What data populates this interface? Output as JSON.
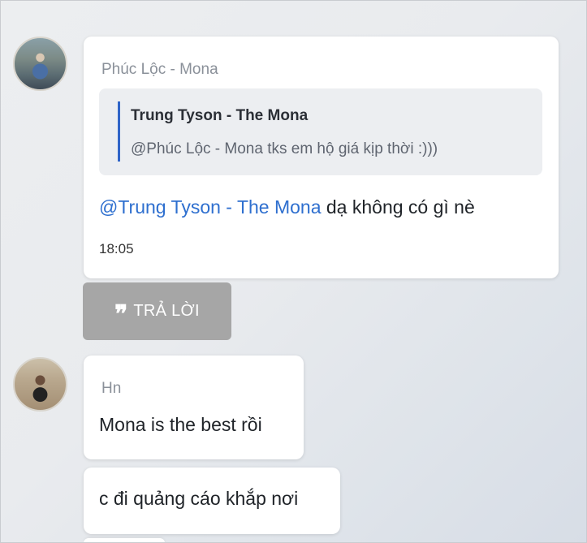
{
  "messages": [
    {
      "sender": "Phúc Lộc - Mona",
      "quote": {
        "author": "Trung Tyson - The Mona",
        "text": "@Phúc Lộc - Mona tks em hộ giá kịp thời :)))"
      },
      "mention": "@Trung Tyson - The Mona",
      "body": " dạ không có gì nè",
      "time": "18:05"
    },
    {
      "sender": "Hn",
      "body": "Mona is the best rồi"
    },
    {
      "body": "c đi quảng cáo khắp nơi"
    }
  ],
  "reply_button": {
    "icon": "quote-icon",
    "label": "TRẢ LỜI"
  },
  "colors": {
    "mention": "#2e6fcf",
    "quote_bar": "#2f64c8",
    "reply_button_bg": "#a6a6a6"
  }
}
